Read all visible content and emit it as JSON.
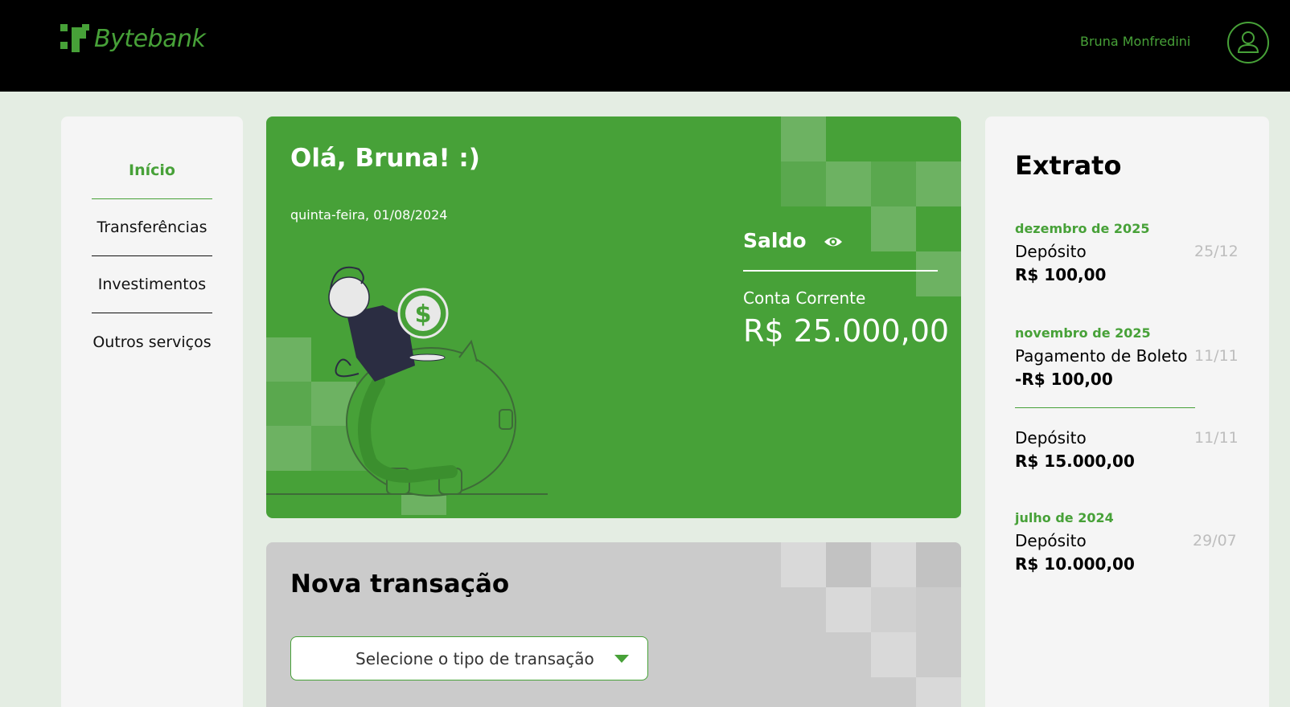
{
  "header": {
    "brand": "Bytebank",
    "user_name": "Bruna Monfredini"
  },
  "sidebar": {
    "items": [
      {
        "label": "Início",
        "active": true
      },
      {
        "label": "Transferências",
        "active": false
      },
      {
        "label": "Investimentos",
        "active": false
      },
      {
        "label": "Outros serviços",
        "active": false
      }
    ]
  },
  "balance_card": {
    "greeting": "Olá, Bruna! :)",
    "date": "quinta-feira, 01/08/2024",
    "saldo_label": "Saldo",
    "account_type": "Conta Corrente",
    "amount": "R$ 25.000,00",
    "illustration_icon": "dollar-coin-piggy-bank",
    "coin_symbol": "$"
  },
  "new_transaction": {
    "title": "Nova transação",
    "select_placeholder": "Selecione o tipo de transação"
  },
  "statement": {
    "title": "Extrato",
    "entries": [
      {
        "month": "dezembro de 2025",
        "type": "Depósito",
        "amount": "R$ 100,00",
        "day": "25/12"
      },
      {
        "month": "novembro de 2025",
        "type": "Pagamento de Boleto",
        "amount": "-R$ 100,00",
        "day": "11/11"
      },
      {
        "month": "",
        "type": "Depósito",
        "amount": "R$ 15.000,00",
        "day": "11/11"
      },
      {
        "month": "julho de 2024",
        "type": "Depósito",
        "amount": "R$ 10.000,00",
        "day": "29/07"
      }
    ]
  },
  "colors": {
    "accent": "#47a138",
    "header_bg": "#000000",
    "page_bg": "#e4ede3",
    "panel_bg": "#f5f5f5",
    "new_tx_bg": "#cbcbcb"
  }
}
